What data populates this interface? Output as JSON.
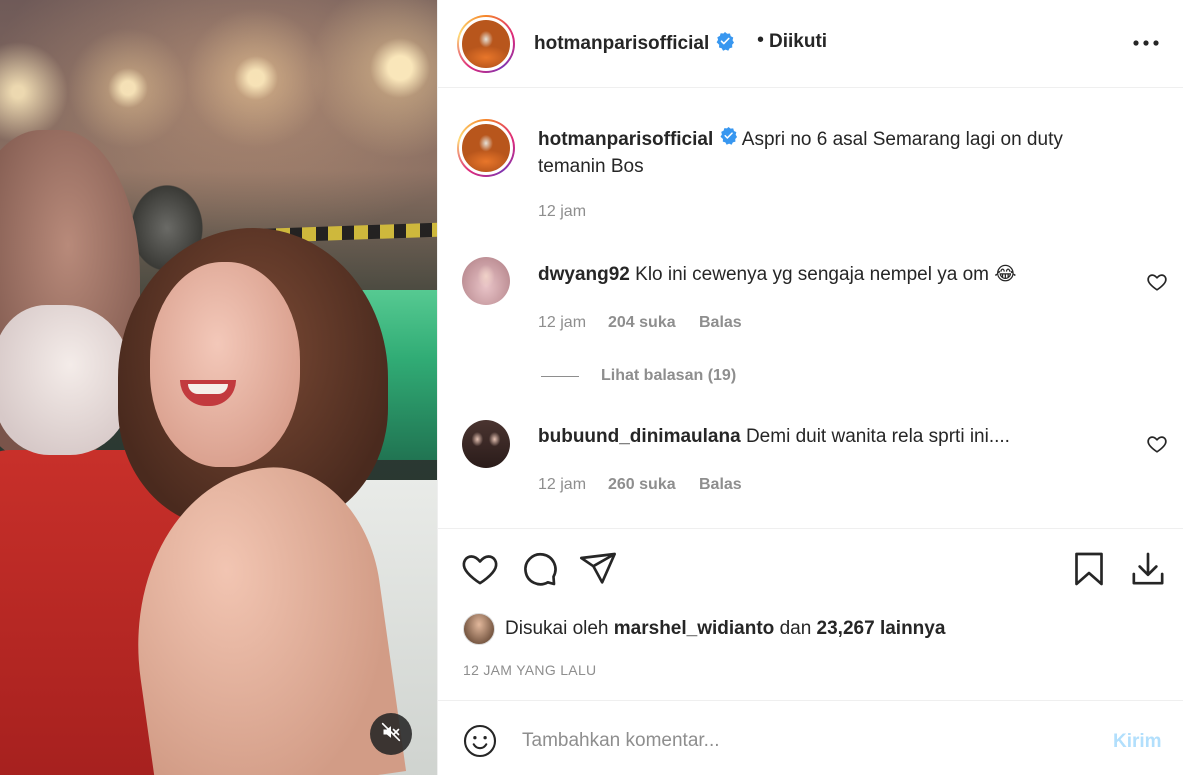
{
  "post": {
    "owner": "hotmanparisofficial",
    "follow_status": "Diikuti",
    "caption": "Aspri no 6 asal Semarang lagi on duty temanin Bos",
    "caption_time": "12 jam"
  },
  "comments": [
    {
      "user": "dwyang92",
      "text": "Klo ini cewenya yg sengaja nempel ya om",
      "emoji": "😂",
      "time": "12 jam",
      "likes": "204 suka",
      "reply_label": "Balas",
      "view_replies": "Lihat balasan (19)"
    },
    {
      "user": "bubuund_dinimaulana",
      "text": "Demi duit wanita rela sprti ini....",
      "time": "12 jam",
      "likes": "260 suka",
      "reply_label": "Balas"
    }
  ],
  "likes": {
    "prefix": "Disukai oleh",
    "user": "marshel_widianto",
    "conjunction": "dan",
    "others": "23,267 lainnya"
  },
  "timestamp": "12 JAM YANG LALU",
  "add_comment": {
    "placeholder": "Tambahkan komentar...",
    "post_label": "Kirim"
  },
  "icons": {
    "verified": "verified-badge-icon",
    "more": "more-options-icon",
    "like": "heart-icon",
    "comment": "comment-bubble-icon",
    "share": "paper-plane-icon",
    "save": "bookmark-icon",
    "download": "download-icon",
    "emoji": "emoji-smile-icon",
    "mute": "speaker-muted-icon"
  },
  "colors": {
    "verified": "#3897f0",
    "muted_text": "#8e8e8e",
    "post_button_disabled": "#b2dffc",
    "text": "#262626"
  }
}
